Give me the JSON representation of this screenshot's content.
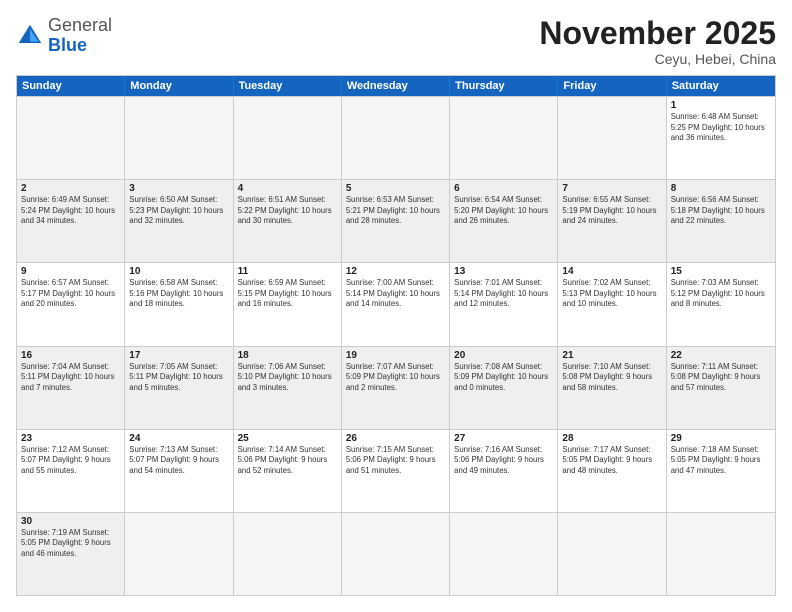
{
  "header": {
    "logo_general": "General",
    "logo_blue": "Blue",
    "month": "November 2025",
    "location": "Ceyu, Hebei, China"
  },
  "days": [
    "Sunday",
    "Monday",
    "Tuesday",
    "Wednesday",
    "Thursday",
    "Friday",
    "Saturday"
  ],
  "rows": [
    [
      {
        "day": "",
        "empty": true
      },
      {
        "day": "",
        "empty": true
      },
      {
        "day": "",
        "empty": true
      },
      {
        "day": "",
        "empty": true
      },
      {
        "day": "",
        "empty": true
      },
      {
        "day": "",
        "empty": true
      },
      {
        "day": "1",
        "info": "Sunrise: 6:48 AM\nSunset: 5:25 PM\nDaylight: 10 hours\nand 36 minutes."
      }
    ],
    [
      {
        "day": "2",
        "shade": true,
        "info": "Sunrise: 6:49 AM\nSunset: 5:24 PM\nDaylight: 10 hours\nand 34 minutes."
      },
      {
        "day": "3",
        "shade": true,
        "info": "Sunrise: 6:50 AM\nSunset: 5:23 PM\nDaylight: 10 hours\nand 32 minutes."
      },
      {
        "day": "4",
        "shade": true,
        "info": "Sunrise: 6:51 AM\nSunset: 5:22 PM\nDaylight: 10 hours\nand 30 minutes."
      },
      {
        "day": "5",
        "shade": true,
        "info": "Sunrise: 6:53 AM\nSunset: 5:21 PM\nDaylight: 10 hours\nand 28 minutes."
      },
      {
        "day": "6",
        "shade": true,
        "info": "Sunrise: 6:54 AM\nSunset: 5:20 PM\nDaylight: 10 hours\nand 26 minutes."
      },
      {
        "day": "7",
        "shade": true,
        "info": "Sunrise: 6:55 AM\nSunset: 5:19 PM\nDaylight: 10 hours\nand 24 minutes."
      },
      {
        "day": "8",
        "shade": true,
        "info": "Sunrise: 6:56 AM\nSunset: 5:18 PM\nDaylight: 10 hours\nand 22 minutes."
      }
    ],
    [
      {
        "day": "9",
        "info": "Sunrise: 6:57 AM\nSunset: 5:17 PM\nDaylight: 10 hours\nand 20 minutes."
      },
      {
        "day": "10",
        "info": "Sunrise: 6:58 AM\nSunset: 5:16 PM\nDaylight: 10 hours\nand 18 minutes."
      },
      {
        "day": "11",
        "info": "Sunrise: 6:59 AM\nSunset: 5:15 PM\nDaylight: 10 hours\nand 16 minutes."
      },
      {
        "day": "12",
        "info": "Sunrise: 7:00 AM\nSunset: 5:14 PM\nDaylight: 10 hours\nand 14 minutes."
      },
      {
        "day": "13",
        "info": "Sunrise: 7:01 AM\nSunset: 5:14 PM\nDaylight: 10 hours\nand 12 minutes."
      },
      {
        "day": "14",
        "info": "Sunrise: 7:02 AM\nSunset: 5:13 PM\nDaylight: 10 hours\nand 10 minutes."
      },
      {
        "day": "15",
        "info": "Sunrise: 7:03 AM\nSunset: 5:12 PM\nDaylight: 10 hours\nand 8 minutes."
      }
    ],
    [
      {
        "day": "16",
        "shade": true,
        "info": "Sunrise: 7:04 AM\nSunset: 5:11 PM\nDaylight: 10 hours\nand 7 minutes."
      },
      {
        "day": "17",
        "shade": true,
        "info": "Sunrise: 7:05 AM\nSunset: 5:11 PM\nDaylight: 10 hours\nand 5 minutes."
      },
      {
        "day": "18",
        "shade": true,
        "info": "Sunrise: 7:06 AM\nSunset: 5:10 PM\nDaylight: 10 hours\nand 3 minutes."
      },
      {
        "day": "19",
        "shade": true,
        "info": "Sunrise: 7:07 AM\nSunset: 5:09 PM\nDaylight: 10 hours\nand 2 minutes."
      },
      {
        "day": "20",
        "shade": true,
        "info": "Sunrise: 7:08 AM\nSunset: 5:09 PM\nDaylight: 10 hours\nand 0 minutes."
      },
      {
        "day": "21",
        "shade": true,
        "info": "Sunrise: 7:10 AM\nSunset: 5:08 PM\nDaylight: 9 hours\nand 58 minutes."
      },
      {
        "day": "22",
        "shade": true,
        "info": "Sunrise: 7:11 AM\nSunset: 5:08 PM\nDaylight: 9 hours\nand 57 minutes."
      }
    ],
    [
      {
        "day": "23",
        "info": "Sunrise: 7:12 AM\nSunset: 5:07 PM\nDaylight: 9 hours\nand 55 minutes."
      },
      {
        "day": "24",
        "info": "Sunrise: 7:13 AM\nSunset: 5:07 PM\nDaylight: 9 hours\nand 54 minutes."
      },
      {
        "day": "25",
        "info": "Sunrise: 7:14 AM\nSunset: 5:06 PM\nDaylight: 9 hours\nand 52 minutes."
      },
      {
        "day": "26",
        "info": "Sunrise: 7:15 AM\nSunset: 5:06 PM\nDaylight: 9 hours\nand 51 minutes."
      },
      {
        "day": "27",
        "info": "Sunrise: 7:16 AM\nSunset: 5:06 PM\nDaylight: 9 hours\nand 49 minutes."
      },
      {
        "day": "28",
        "info": "Sunrise: 7:17 AM\nSunset: 5:05 PM\nDaylight: 9 hours\nand 48 minutes."
      },
      {
        "day": "29",
        "info": "Sunrise: 7:18 AM\nSunset: 5:05 PM\nDaylight: 9 hours\nand 47 minutes."
      }
    ],
    [
      {
        "day": "30",
        "shade": true,
        "info": "Sunrise: 7:19 AM\nSunset: 5:05 PM\nDaylight: 9 hours\nand 46 minutes."
      },
      {
        "day": "",
        "empty": true
      },
      {
        "day": "",
        "empty": true
      },
      {
        "day": "",
        "empty": true
      },
      {
        "day": "",
        "empty": true
      },
      {
        "day": "",
        "empty": true
      },
      {
        "day": "",
        "empty": true
      }
    ]
  ]
}
